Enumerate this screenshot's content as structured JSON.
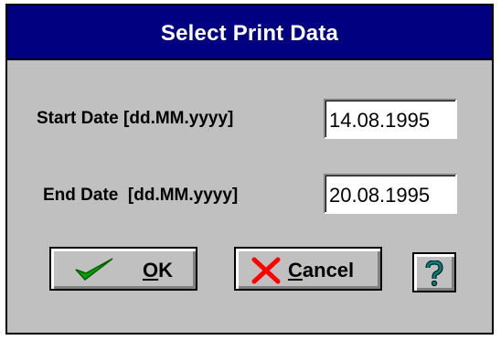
{
  "dialog": {
    "title": "Select Print Data",
    "start_date": {
      "label": "Start Date [dd.MM.yyyy]",
      "value": "14.08.1995"
    },
    "end_date": {
      "label": "End Date  [dd.MM.yyyy]",
      "value": "20.08.1995"
    },
    "buttons": {
      "ok": {
        "mnemonic": "O",
        "rest": "K",
        "icon": "checkmark-icon"
      },
      "cancel": {
        "mnemonic": "C",
        "rest": "ancel",
        "icon": "x-icon"
      },
      "help": {
        "icon": "question-icon"
      }
    }
  },
  "colors": {
    "title_bar": "#000080",
    "dialog_bg": "#c0c0c0",
    "check": "#00a000",
    "cross": "#ff0000",
    "help_glyph": "#008080"
  }
}
